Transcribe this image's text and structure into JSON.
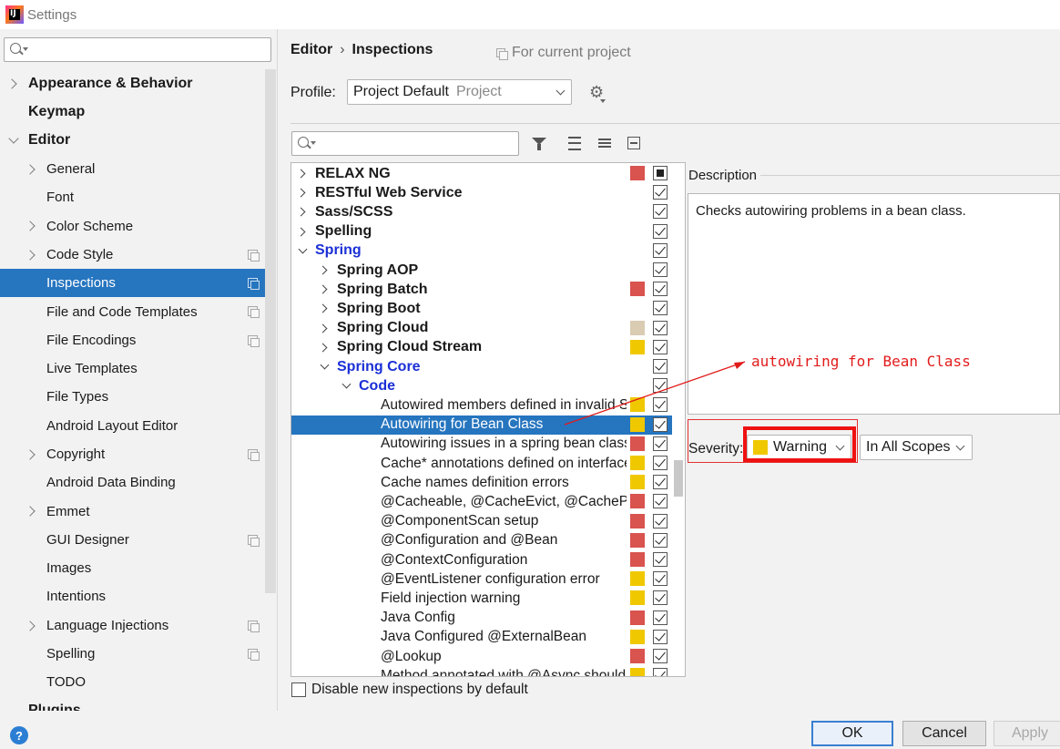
{
  "window": {
    "title": "Settings",
    "logo_text": "IJ"
  },
  "sidebar": {
    "search_placeholder": "",
    "items": [
      {
        "label": "Appearance & Behavior",
        "level": 0,
        "bold": true,
        "expander": "right",
        "copy": false
      },
      {
        "label": "Keymap",
        "level": 0,
        "bold": true,
        "expander": "none",
        "copy": false
      },
      {
        "label": "Editor",
        "level": 0,
        "bold": true,
        "expander": "down",
        "copy": false
      },
      {
        "label": "General",
        "level": 1,
        "bold": false,
        "expander": "right",
        "copy": false
      },
      {
        "label": "Font",
        "level": 1,
        "bold": false,
        "expander": "none",
        "copy": false
      },
      {
        "label": "Color Scheme",
        "level": 1,
        "bold": false,
        "expander": "right",
        "copy": false
      },
      {
        "label": "Code Style",
        "level": 1,
        "bold": false,
        "expander": "right",
        "copy": true
      },
      {
        "label": "Inspections",
        "level": 1,
        "bold": false,
        "expander": "none",
        "copy": true,
        "selected": true
      },
      {
        "label": "File and Code Templates",
        "level": 1,
        "bold": false,
        "expander": "none",
        "copy": true
      },
      {
        "label": "File Encodings",
        "level": 1,
        "bold": false,
        "expander": "none",
        "copy": true
      },
      {
        "label": "Live Templates",
        "level": 1,
        "bold": false,
        "expander": "none",
        "copy": false
      },
      {
        "label": "File Types",
        "level": 1,
        "bold": false,
        "expander": "none",
        "copy": false
      },
      {
        "label": "Android Layout Editor",
        "level": 1,
        "bold": false,
        "expander": "none",
        "copy": false
      },
      {
        "label": "Copyright",
        "level": 1,
        "bold": false,
        "expander": "right",
        "copy": true
      },
      {
        "label": "Android Data Binding",
        "level": 1,
        "bold": false,
        "expander": "none",
        "copy": false
      },
      {
        "label": "Emmet",
        "level": 1,
        "bold": false,
        "expander": "right",
        "copy": false
      },
      {
        "label": "GUI Designer",
        "level": 1,
        "bold": false,
        "expander": "none",
        "copy": true
      },
      {
        "label": "Images",
        "level": 1,
        "bold": false,
        "expander": "none",
        "copy": false
      },
      {
        "label": "Intentions",
        "level": 1,
        "bold": false,
        "expander": "none",
        "copy": false
      },
      {
        "label": "Language Injections",
        "level": 1,
        "bold": false,
        "expander": "right",
        "copy": true
      },
      {
        "label": "Spelling",
        "level": 1,
        "bold": false,
        "expander": "none",
        "copy": true
      },
      {
        "label": "TODO",
        "level": 1,
        "bold": false,
        "expander": "none",
        "copy": false
      },
      {
        "label": "Plugins",
        "level": 0,
        "bold": true,
        "expander": "none",
        "copy": false
      }
    ]
  },
  "header": {
    "breadcrumb": [
      "Editor",
      "Inspections"
    ],
    "breadcrumb_sep": "›",
    "scope_note": "For current project"
  },
  "profile": {
    "label": "Profile:",
    "value": "Project Default",
    "scope": "Project"
  },
  "inspections": {
    "search_placeholder": "",
    "rows": [
      {
        "label": "RELAX NG",
        "level": 0,
        "bold": true,
        "blue": false,
        "expander": "right",
        "severity_color": "#d9534f",
        "check": "partial"
      },
      {
        "label": "RESTful Web Service",
        "level": 0,
        "bold": true,
        "blue": false,
        "expander": "right",
        "severity_color": "",
        "check": "checked"
      },
      {
        "label": "Sass/SCSS",
        "level": 0,
        "bold": true,
        "blue": false,
        "expander": "right",
        "severity_color": "",
        "check": "checked"
      },
      {
        "label": "Spelling",
        "level": 0,
        "bold": true,
        "blue": false,
        "expander": "right",
        "severity_color": "",
        "check": "checked"
      },
      {
        "label": "Spring",
        "level": 0,
        "bold": true,
        "blue": true,
        "expander": "down",
        "severity_color": "",
        "check": "checked"
      },
      {
        "label": "Spring AOP",
        "level": 1,
        "bold": true,
        "blue": false,
        "expander": "right",
        "severity_color": "",
        "check": "checked"
      },
      {
        "label": "Spring Batch",
        "level": 1,
        "bold": true,
        "blue": false,
        "expander": "right",
        "severity_color": "#d9534f",
        "check": "checked"
      },
      {
        "label": "Spring Boot",
        "level": 1,
        "bold": true,
        "blue": false,
        "expander": "right",
        "severity_color": "",
        "check": "checked"
      },
      {
        "label": "Spring Cloud",
        "level": 1,
        "bold": true,
        "blue": false,
        "expander": "right",
        "severity_color": "#d9ccb2",
        "check": "checked"
      },
      {
        "label": "Spring Cloud Stream",
        "level": 1,
        "bold": true,
        "blue": false,
        "expander": "right",
        "severity_color": "#f0c800",
        "check": "checked"
      },
      {
        "label": "Spring Core",
        "level": 1,
        "bold": true,
        "blue": true,
        "expander": "down",
        "severity_color": "",
        "check": "checked"
      },
      {
        "label": "Code",
        "level": 2,
        "bold": true,
        "blue": true,
        "expander": "down",
        "severity_color": "",
        "check": "checked"
      },
      {
        "label": "Autowired members defined in invalid Spring bean",
        "level": 3,
        "bold": false,
        "blue": false,
        "expander": "none",
        "severity_color": "#f0c800",
        "check": "checked"
      },
      {
        "label": "Autowiring for Bean Class",
        "level": 3,
        "bold": false,
        "blue": false,
        "expander": "none",
        "severity_color": "#f0c800",
        "check": "checked",
        "selected": true
      },
      {
        "label": "Autowiring issues in a spring bean class",
        "level": 3,
        "bold": false,
        "blue": false,
        "expander": "none",
        "severity_color": "#d9534f",
        "check": "checked"
      },
      {
        "label": "Cache* annotations defined on interface",
        "level": 3,
        "bold": false,
        "blue": false,
        "expander": "none",
        "severity_color": "#f0c800",
        "check": "checked"
      },
      {
        "label": "Cache names definition errors",
        "level": 3,
        "bold": false,
        "blue": false,
        "expander": "none",
        "severity_color": "#f0c800",
        "check": "checked"
      },
      {
        "label": "@Cacheable, @CacheEvict, @CachePut",
        "level": 3,
        "bold": false,
        "blue": false,
        "expander": "none",
        "severity_color": "#d9534f",
        "check": "checked"
      },
      {
        "label": "@ComponentScan setup",
        "level": 3,
        "bold": false,
        "blue": false,
        "expander": "none",
        "severity_color": "#d9534f",
        "check": "checked"
      },
      {
        "label": "@Configuration and @Bean",
        "level": 3,
        "bold": false,
        "blue": false,
        "expander": "none",
        "severity_color": "#d9534f",
        "check": "checked"
      },
      {
        "label": "@ContextConfiguration",
        "level": 3,
        "bold": false,
        "blue": false,
        "expander": "none",
        "severity_color": "#d9534f",
        "check": "checked"
      },
      {
        "label": "@EventListener configuration error",
        "level": 3,
        "bold": false,
        "blue": false,
        "expander": "none",
        "severity_color": "#f0c800",
        "check": "checked"
      },
      {
        "label": "Field injection warning",
        "level": 3,
        "bold": false,
        "blue": false,
        "expander": "none",
        "severity_color": "#f0c800",
        "check": "checked"
      },
      {
        "label": "Java Config",
        "level": 3,
        "bold": false,
        "blue": false,
        "expander": "none",
        "severity_color": "#d9534f",
        "check": "checked"
      },
      {
        "label": "Java Configured @ExternalBean",
        "level": 3,
        "bold": false,
        "blue": false,
        "expander": "none",
        "severity_color": "#f0c800",
        "check": "checked"
      },
      {
        "label": "@Lookup",
        "level": 3,
        "bold": false,
        "blue": false,
        "expander": "none",
        "severity_color": "#d9534f",
        "check": "checked"
      },
      {
        "label": "Method annotated with @Async should",
        "level": 3,
        "bold": false,
        "blue": false,
        "expander": "none",
        "severity_color": "#f0c800",
        "check": "checked"
      }
    ],
    "disable_new_label": "Disable new inspections by default"
  },
  "description": {
    "label": "Description",
    "text": "Checks autowiring problems in a bean class."
  },
  "severity": {
    "label": "Severity:",
    "value": "Warning",
    "color": "#f0c800",
    "scope": "In All Scopes"
  },
  "annotation": {
    "text": "autowiring for Bean Class",
    "color": "#e21b1b"
  },
  "buttons": {
    "ok": "OK",
    "cancel": "Cancel",
    "apply": "Apply",
    "help": "?"
  }
}
